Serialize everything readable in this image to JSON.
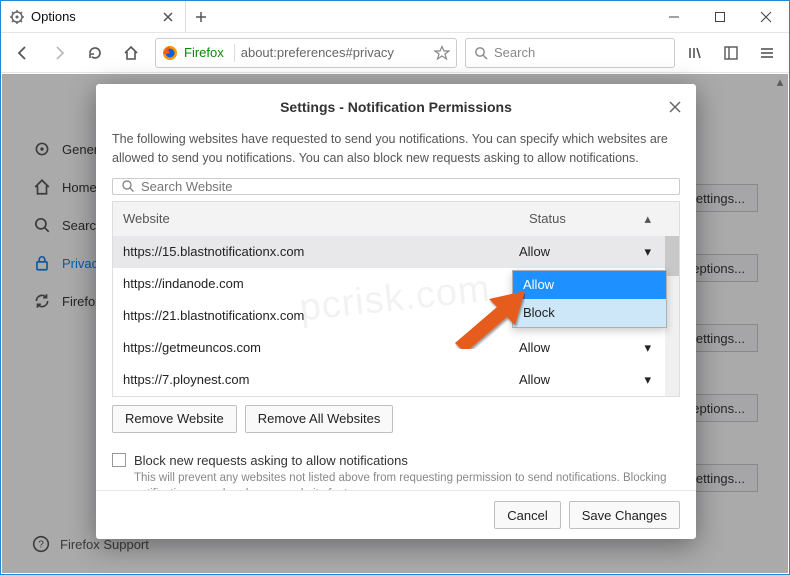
{
  "window": {
    "tab_title": "Options",
    "url_identity": "Firefox",
    "url_text": "about:preferences#privacy",
    "search_placeholder": "Search"
  },
  "sidebar": {
    "items": [
      {
        "label": "General"
      },
      {
        "label": "Home"
      },
      {
        "label": "Search"
      },
      {
        "label": "Privacy & Security"
      },
      {
        "label": "Firefox Account"
      }
    ],
    "support": "Firefox Support"
  },
  "ghost_buttons": [
    "Settings...",
    "Exceptions...",
    "Settings...",
    "Exceptions...",
    "Settings..."
  ],
  "dialog": {
    "title": "Settings - Notification Permissions",
    "description": "The following websites have requested to send you notifications. You can specify which websites are allowed to send you notifications. You can also block new requests asking to allow notifications.",
    "search_placeholder": "Search Website",
    "columns": {
      "website": "Website",
      "status": "Status"
    },
    "rows": [
      {
        "site": "https://15.blastnotificationx.com",
        "status": "Allow",
        "selected": true
      },
      {
        "site": "https://indanode.com",
        "status": "Allow"
      },
      {
        "site": "https://21.blastnotificationx.com",
        "status": "Allow"
      },
      {
        "site": "https://getmeuncos.com",
        "status": "Allow"
      },
      {
        "site": "https://7.ploynest.com",
        "status": "Allow"
      }
    ],
    "dropdown": {
      "options": [
        "Allow",
        "Block"
      ],
      "highlighted": "Block"
    },
    "remove_website": "Remove Website",
    "remove_all": "Remove All Websites",
    "block_label": "Block new requests asking to allow notifications",
    "block_desc": "This will prevent any websites not listed above from requesting permission to send notifications. Blocking notifications may break some website features.",
    "cancel": "Cancel",
    "save": "Save Changes"
  },
  "watermark": "pcrisk.com"
}
